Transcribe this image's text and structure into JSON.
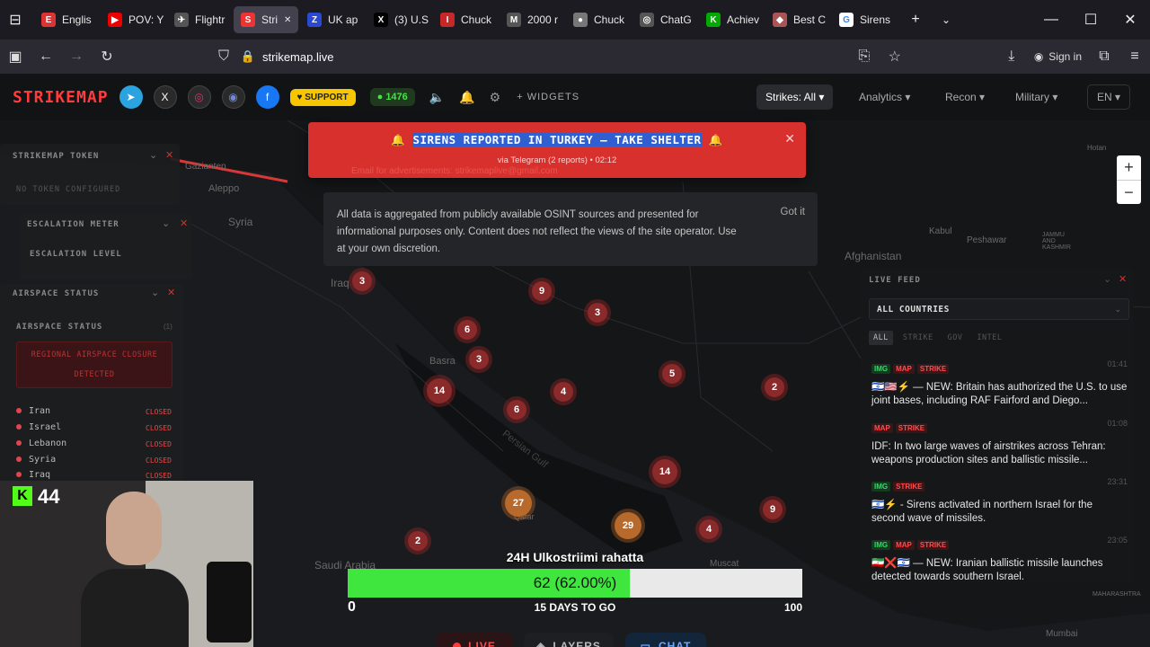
{
  "browser": {
    "tabs": [
      {
        "label": "Englis",
        "icon": "E",
        "color": "#d33"
      },
      {
        "label": "POV: Y",
        "icon": "▶",
        "color": "#e00"
      },
      {
        "label": "Flightr",
        "icon": "✈",
        "color": "#555"
      },
      {
        "label": "Stri",
        "icon": "S",
        "color": "#e33",
        "active": true
      },
      {
        "label": "UK ap",
        "icon": "Z",
        "color": "#2b4ad3"
      },
      {
        "label": "(3) U.S",
        "icon": "X",
        "color": "#000"
      },
      {
        "label": "Chuck",
        "icon": "I",
        "color": "#c62828"
      },
      {
        "label": "2000 r",
        "icon": "M",
        "color": "#555"
      },
      {
        "label": "Chuck",
        "icon": "●",
        "color": "#777"
      },
      {
        "label": "ChatG",
        "icon": "◎",
        "color": "#555"
      },
      {
        "label": "Achiev",
        "icon": "K",
        "color": "#0a0"
      },
      {
        "label": "Best C",
        "icon": "◆",
        "color": "#a55"
      },
      {
        "label": "Sirens",
        "icon": "G",
        "color": "#fff"
      }
    ],
    "url": "strikemap.live",
    "sign_in": "Sign in"
  },
  "header": {
    "logo": "STRIKEMAP",
    "support": "SUPPORT",
    "online_count": "1476",
    "widgets": "WIDGETS",
    "menus": [
      "Strikes: All",
      "Analytics",
      "Recon",
      "Military",
      "EN"
    ]
  },
  "alert": {
    "title": "SIRENS REPORTED IN TURKEY — TAKE SHELTER",
    "subtitle": "via Telegram (2 reports) • 02:12",
    "ad": "Email for advertisements: strikemaplive@gmail.com"
  },
  "disclaimer": {
    "text": "All data is aggregated from publicly available OSINT sources and presented for informational purposes only. Content does not reflect the views of the site operator. Use at your own discretion.",
    "button": "Got it"
  },
  "token_panel": {
    "title": "STRIKEMAP TOKEN",
    "status": "NO TOKEN CONFIGURED"
  },
  "escalation_panel": {
    "title": "ESCALATION METER",
    "label": "ESCALATION LEVEL"
  },
  "airspace_panel": {
    "title": "AIRSPACE STATUS",
    "subtitle": "AIRSPACE STATUS",
    "count": "(1)",
    "alert": "REGIONAL AIRSPACE CLOSURE DETECTED",
    "countries": [
      {
        "name": "Iran",
        "status": "CLOSED"
      },
      {
        "name": "Israel",
        "status": "CLOSED"
      },
      {
        "name": "Lebanon",
        "status": "CLOSED"
      },
      {
        "name": "Syria",
        "status": "CLOSED"
      },
      {
        "name": "Iraq",
        "status": "CLOSED"
      }
    ]
  },
  "map_labels": [
    "Gaziantep",
    "Aleppo",
    "Syria",
    "Iraq",
    "Basra",
    "Persian Gulf",
    "Qatar",
    "Saudi Arabia",
    "Muscat",
    "Afghanistan",
    "Kabul",
    "Peshawar",
    "Hotan",
    "Mumbai",
    "JAMMU AND KASHMIR",
    "MAHARASHTRA"
  ],
  "clusters": [
    "3",
    "9",
    "3",
    "6",
    "3",
    "14",
    "4",
    "6",
    "5",
    "2",
    "14",
    "27",
    "29",
    "4",
    "9",
    "2"
  ],
  "live_feed": {
    "title": "LIVE FEED",
    "filter": "ALL COUNTRIES",
    "tabs": [
      "ALL",
      "STRIKE",
      "GOV",
      "INTEL"
    ],
    "items": [
      {
        "tags": [
          "IMG",
          "MAP",
          "STRIKE"
        ],
        "time": "01:41",
        "text": "🇮🇱🇺🇸⚡ — NEW: Britain has authorized the U.S. to use joint bases, including RAF Fairford and Diego..."
      },
      {
        "tags": [
          "MAP",
          "STRIKE"
        ],
        "time": "01:08",
        "text": "IDF: In two large waves of airstrikes across Tehran: weapons production sites and ballistic missile..."
      },
      {
        "tags": [
          "IMG",
          "STRIKE"
        ],
        "time": "23:31",
        "text": "🇮🇱⚡ - Sirens activated in northern Israel for the second wave of missiles."
      },
      {
        "tags": [
          "IMG",
          "MAP",
          "STRIKE"
        ],
        "time": "23:05",
        "text": "🇮🇷❌🇮🇱 — NEW: Iranian ballistic missile launches detected towards southern Israel."
      }
    ]
  },
  "overlay": {
    "title": "24H Ulkostriimi rahatta",
    "value_label": "62 (62.00%)",
    "progress": 0.62,
    "min": "0",
    "max": "100",
    "days": "15 DAYS TO GO",
    "counter": "44"
  },
  "bottom_buttons": [
    "LIVE",
    "LAYERS",
    "CHAT"
  ]
}
